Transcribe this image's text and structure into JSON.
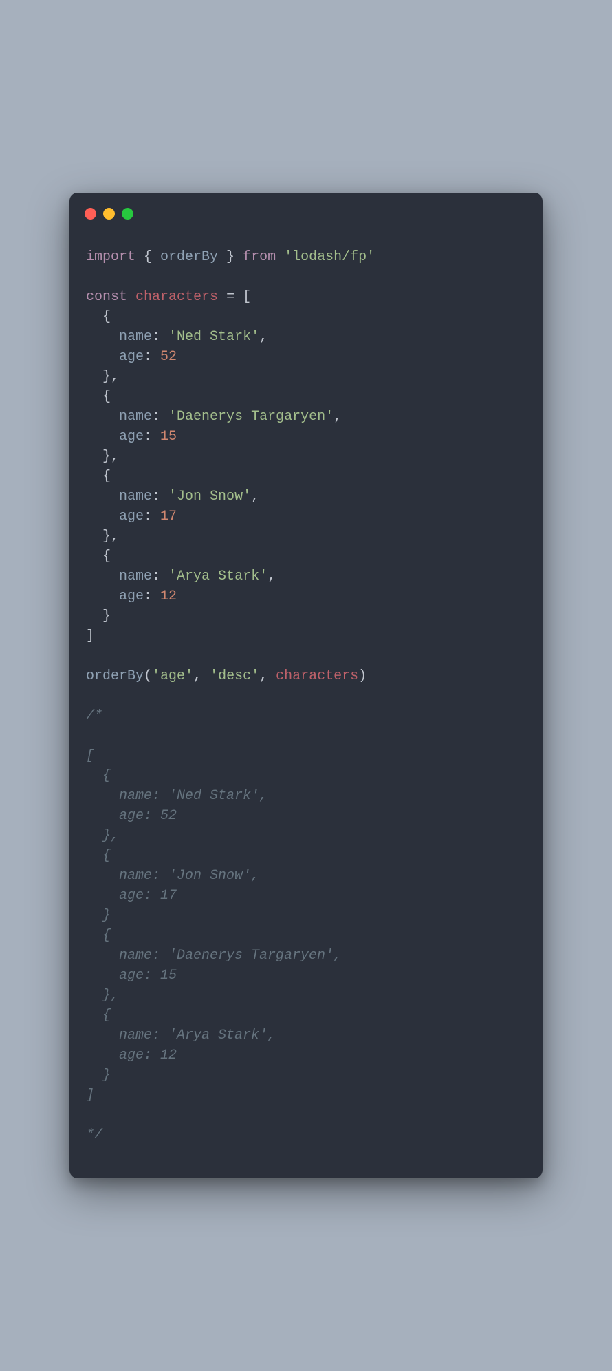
{
  "tokens": [
    [
      {
        "c": "kw",
        "t": "import"
      },
      {
        "c": "pun",
        "t": " { "
      },
      {
        "c": "fn",
        "t": "orderBy"
      },
      {
        "c": "pun",
        "t": " } "
      },
      {
        "c": "kw",
        "t": "from"
      },
      {
        "c": "pun",
        "t": " "
      },
      {
        "c": "str",
        "t": "'lodash/fp'"
      }
    ],
    [],
    [
      {
        "c": "kw",
        "t": "const"
      },
      {
        "c": "pun",
        "t": " "
      },
      {
        "c": "var",
        "t": "characters"
      },
      {
        "c": "pun",
        "t": " = ["
      }
    ],
    [
      {
        "c": "pun",
        "t": "  {"
      }
    ],
    [
      {
        "c": "pun",
        "t": "    "
      },
      {
        "c": "key",
        "t": "name"
      },
      {
        "c": "pun",
        "t": ": "
      },
      {
        "c": "str",
        "t": "'Ned Stark'"
      },
      {
        "c": "pun",
        "t": ","
      }
    ],
    [
      {
        "c": "pun",
        "t": "    "
      },
      {
        "c": "key",
        "t": "age"
      },
      {
        "c": "pun",
        "t": ": "
      },
      {
        "c": "num",
        "t": "52"
      }
    ],
    [
      {
        "c": "pun",
        "t": "  },"
      }
    ],
    [
      {
        "c": "pun",
        "t": "  {"
      }
    ],
    [
      {
        "c": "pun",
        "t": "    "
      },
      {
        "c": "key",
        "t": "name"
      },
      {
        "c": "pun",
        "t": ": "
      },
      {
        "c": "str",
        "t": "'Daenerys Targaryen'"
      },
      {
        "c": "pun",
        "t": ","
      }
    ],
    [
      {
        "c": "pun",
        "t": "    "
      },
      {
        "c": "key",
        "t": "age"
      },
      {
        "c": "pun",
        "t": ": "
      },
      {
        "c": "num",
        "t": "15"
      }
    ],
    [
      {
        "c": "pun",
        "t": "  },"
      }
    ],
    [
      {
        "c": "pun",
        "t": "  {"
      }
    ],
    [
      {
        "c": "pun",
        "t": "    "
      },
      {
        "c": "key",
        "t": "name"
      },
      {
        "c": "pun",
        "t": ": "
      },
      {
        "c": "str",
        "t": "'Jon Snow'"
      },
      {
        "c": "pun",
        "t": ","
      }
    ],
    [
      {
        "c": "pun",
        "t": "    "
      },
      {
        "c": "key",
        "t": "age"
      },
      {
        "c": "pun",
        "t": ": "
      },
      {
        "c": "num",
        "t": "17"
      }
    ],
    [
      {
        "c": "pun",
        "t": "  },"
      }
    ],
    [
      {
        "c": "pun",
        "t": "  {"
      }
    ],
    [
      {
        "c": "pun",
        "t": "    "
      },
      {
        "c": "key",
        "t": "name"
      },
      {
        "c": "pun",
        "t": ": "
      },
      {
        "c": "str",
        "t": "'Arya Stark'"
      },
      {
        "c": "pun",
        "t": ","
      }
    ],
    [
      {
        "c": "pun",
        "t": "    "
      },
      {
        "c": "key",
        "t": "age"
      },
      {
        "c": "pun",
        "t": ": "
      },
      {
        "c": "num",
        "t": "12"
      }
    ],
    [
      {
        "c": "pun",
        "t": "  }"
      }
    ],
    [
      {
        "c": "pun",
        "t": "]"
      }
    ],
    [],
    [
      {
        "c": "fn",
        "t": "orderBy"
      },
      {
        "c": "pun",
        "t": "("
      },
      {
        "c": "str",
        "t": "'age'"
      },
      {
        "c": "pun",
        "t": ", "
      },
      {
        "c": "str",
        "t": "'desc'"
      },
      {
        "c": "pun",
        "t": ", "
      },
      {
        "c": "var",
        "t": "characters"
      },
      {
        "c": "pun",
        "t": ")"
      }
    ],
    [],
    [
      {
        "c": "cmt",
        "t": "/*"
      }
    ],
    [],
    [
      {
        "c": "cmt",
        "t": "["
      }
    ],
    [
      {
        "c": "cmt",
        "t": "  {"
      }
    ],
    [
      {
        "c": "cmt",
        "t": "    name: 'Ned Stark',"
      }
    ],
    [
      {
        "c": "cmt",
        "t": "    age: 52"
      }
    ],
    [
      {
        "c": "cmt",
        "t": "  },"
      }
    ],
    [
      {
        "c": "cmt",
        "t": "  {"
      }
    ],
    [
      {
        "c": "cmt",
        "t": "    name: 'Jon Snow',"
      }
    ],
    [
      {
        "c": "cmt",
        "t": "    age: 17"
      }
    ],
    [
      {
        "c": "cmt",
        "t": "  }"
      }
    ],
    [
      {
        "c": "cmt",
        "t": "  {"
      }
    ],
    [
      {
        "c": "cmt",
        "t": "    name: 'Daenerys Targaryen',"
      }
    ],
    [
      {
        "c": "cmt",
        "t": "    age: 15"
      }
    ],
    [
      {
        "c": "cmt",
        "t": "  },"
      }
    ],
    [
      {
        "c": "cmt",
        "t": "  {"
      }
    ],
    [
      {
        "c": "cmt",
        "t": "    name: 'Arya Stark',"
      }
    ],
    [
      {
        "c": "cmt",
        "t": "    age: 12"
      }
    ],
    [
      {
        "c": "cmt",
        "t": "  }"
      }
    ],
    [
      {
        "c": "cmt",
        "t": "]"
      }
    ],
    [],
    [
      {
        "c": "cmt",
        "t": "*/"
      }
    ]
  ]
}
